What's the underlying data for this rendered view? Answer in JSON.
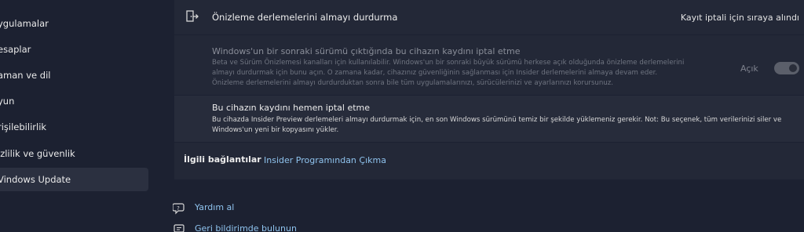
{
  "sidebar": {
    "items": [
      {
        "label": "ygulamalar"
      },
      {
        "label": "esaplar"
      },
      {
        "label": "aman ve dil"
      },
      {
        "label": "yun"
      },
      {
        "label": "rişilebilirlik"
      },
      {
        "label": "izlilik ve güvenlik"
      },
      {
        "label": "Vindows Update",
        "selected": true
      }
    ]
  },
  "main": {
    "stop_previews": {
      "title": "Önizleme derlemelerini almayı durdurma",
      "status": "Kayıt iptali için sıraya alındı",
      "icon": "exit-icon"
    },
    "unenroll_next_release": {
      "title": "Windows'un bir sonraki sürümü çıktığında bu cihazın kaydını iptal etme",
      "description": "Beta ve Sürüm Önizlemesi kanalları için kullanılabilir. Windows'un bir sonraki büyük sürümü herkese açık olduğunda önizleme derlemelerini almayı durdurmak için bunu açın. O zamana kadar, cihazınız güvenliğinin sağlanması için Insider derlemelerini almaya devam eder. Önizleme derlemelerini almayı durdurduktan sonra bile tüm uygulamalarınızı, sürücülerinizi ve ayarlarınızı korursunuz.",
      "toggle_label": "Açık",
      "toggle_on": true,
      "disabled": true
    },
    "unenroll_now": {
      "title": "Bu cihazın kaydını hemen iptal etme",
      "description": "Bu cihazda Insider Preview derlemeleri almayı durdurmak için, en son Windows sürümünü temiz bir şekilde yüklemeniz gerekir. Not: Bu seçenek, tüm verilerinizi siler ve Windows'un yeni bir kopyasını yükler."
    },
    "related_links": {
      "heading": "İlgili bağlantılar",
      "link": "Insider Programından Çıkma"
    }
  },
  "help": {
    "get_help": "Yardım al",
    "feedback": "Geri bildirimde bulunun"
  },
  "colors": {
    "background": "#1c2131",
    "card": "#232837",
    "link": "#8fc3ee"
  }
}
